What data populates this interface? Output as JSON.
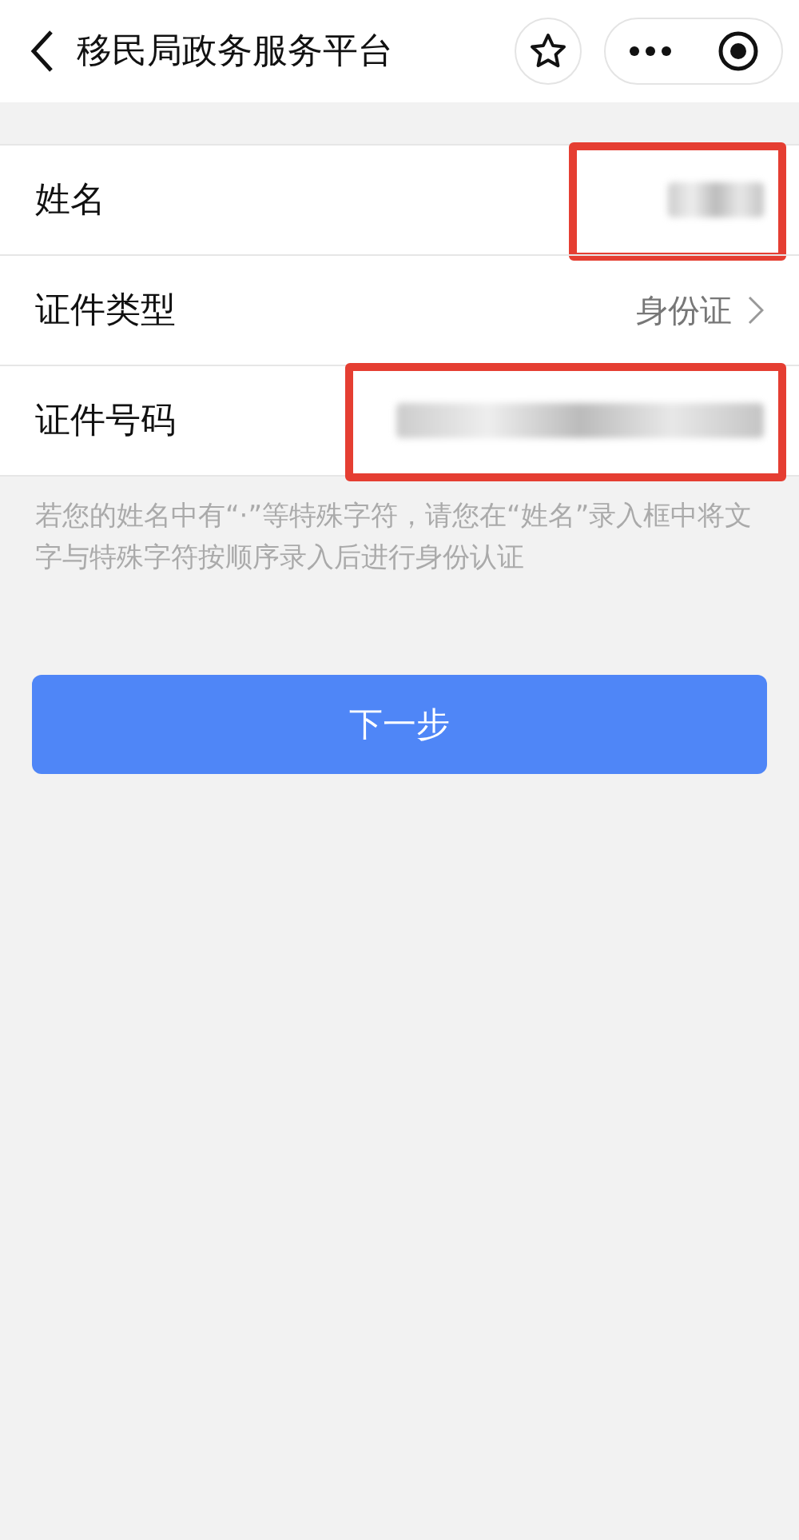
{
  "header": {
    "title": "移民局政务服务平台"
  },
  "fields": [
    {
      "label": "姓名",
      "kind": "masked",
      "highlighted": true
    },
    {
      "label": "证件类型",
      "kind": "select",
      "value": "身份证",
      "highlighted": false
    },
    {
      "label": "证件号码",
      "kind": "masked",
      "highlighted": true
    }
  ],
  "note": "若您的姓名中有“·”等特殊字符，请您在“姓名”录入框中将文字与特殊字符按顺序录入后进行身份认证",
  "button": {
    "label": "下一步"
  }
}
